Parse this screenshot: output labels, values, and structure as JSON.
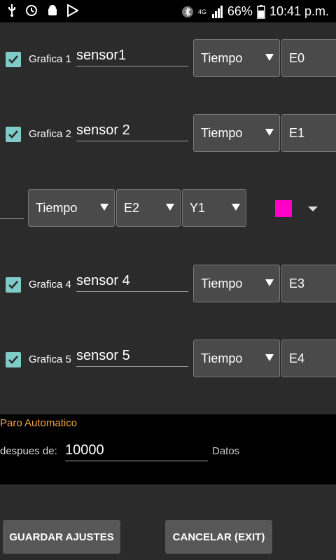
{
  "status": {
    "battery": "66%",
    "time": "10:41 p.m.",
    "network": "4G"
  },
  "rows": [
    {
      "check_label": "Grafica 1",
      "name": "sensor1",
      "mode": "Tiempo",
      "channel": "E0"
    },
    {
      "check_label": "Grafica 2",
      "name": "sensor 2",
      "mode": "Tiempo",
      "channel": "E1"
    },
    {
      "check_label": "",
      "name": "",
      "mode": "Tiempo",
      "channel": "E2",
      "axis": "Y1",
      "color": "#ff00c8"
    },
    {
      "check_label": "Grafica 4",
      "name": "sensor 4",
      "mode": "Tiempo",
      "channel": "E3"
    },
    {
      "check_label": "Grafica 5",
      "name": "sensor 5",
      "mode": "Tiempo",
      "channel": "E4"
    }
  ],
  "paro": {
    "title": "Paro Automatico",
    "label": "despues de:",
    "value": "10000",
    "unit": "Datos"
  },
  "buttons": {
    "save": "GUARDAR AJUSTES",
    "cancel": "CANCELAR (EXIT)"
  }
}
